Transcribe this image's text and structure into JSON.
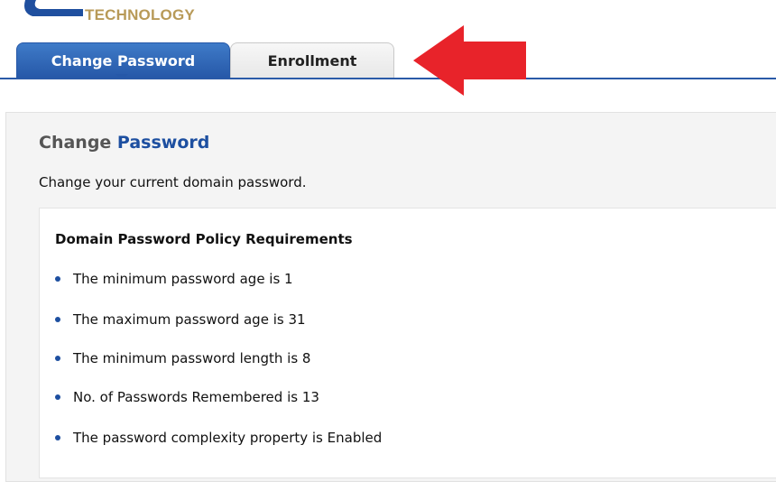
{
  "header": {
    "logo_text": "TECHNOLOGY"
  },
  "tabs": [
    {
      "label": "Change Password",
      "active": true
    },
    {
      "label": "Enrollment",
      "active": false
    }
  ],
  "panel": {
    "title_part1": "Change ",
    "title_part2": "Password",
    "description": "Change your current domain password.",
    "policy": {
      "heading": "Domain Password Policy Requirements",
      "requirements": [
        "The minimum password age is 1",
        "The maximum password age is 31",
        "The minimum password length is 8",
        "No. of Passwords Remembered is 13",
        "The password complexity property is Enabled"
      ]
    }
  },
  "colors": {
    "accent_blue": "#2658a8",
    "logo_gold": "#b89a58",
    "annotation_red": "#e8232a"
  }
}
